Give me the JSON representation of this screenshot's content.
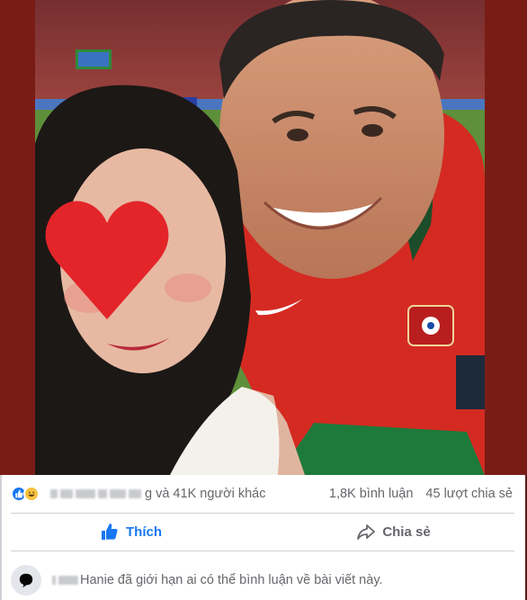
{
  "post": {
    "image": {
      "icon": "selfie-photo",
      "heart_color": "#e3252a",
      "frame_color": "#7a1c16",
      "shirt_color": "#d42a22"
    }
  },
  "reactions": {
    "icons": [
      "like-icon",
      "haha-icon"
    ],
    "summary_text": "g và 41K người khác",
    "comments": "1,8K bình luận",
    "shares": "45 lượt chia sẻ"
  },
  "actions": {
    "like_label": "Thích",
    "share_label": "Chia sẻ",
    "accent": "#1877f2"
  },
  "notice": {
    "icon": "comment-bubble-icon",
    "text": "Hanie đã giới hạn ai có thể bình luận về bài viết này."
  }
}
